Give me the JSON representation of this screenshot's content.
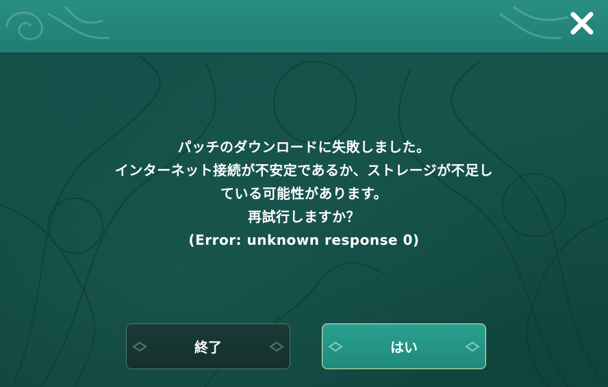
{
  "dialog": {
    "message_lines": [
      "パッチのダウンロードに失敗しました。",
      "インターネット接続が不安定であるか、ストレージが不足し",
      "ている可能性があります。",
      "再試行しますか？",
      "(Error: unknown response 0)"
    ],
    "close_icon": "close-icon"
  },
  "buttons": {
    "quit_label": "終了",
    "yes_label": "はい"
  },
  "colors": {
    "header": "#2a8f83",
    "body": "#114a43",
    "quit_button": "#1a3a36",
    "yes_button": "#2aa08f",
    "yes_border": "#d6e4a2"
  }
}
